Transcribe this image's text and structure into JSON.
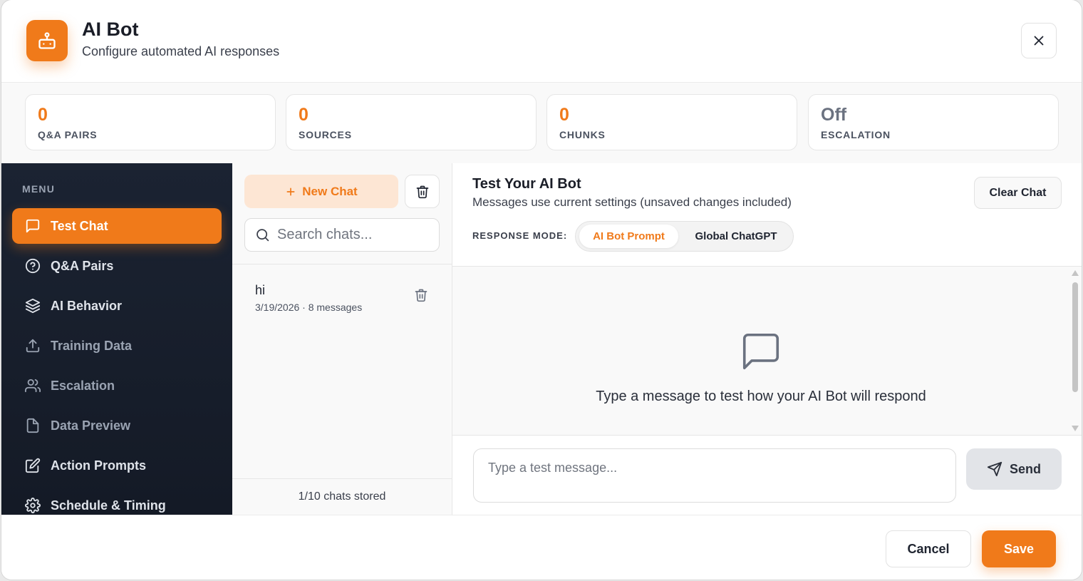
{
  "header": {
    "title": "AI Bot",
    "subtitle": "Configure automated AI responses",
    "icon": "robot-icon"
  },
  "stats": [
    {
      "value": "0",
      "label": "Q&A PAIRS"
    },
    {
      "value": "0",
      "label": "SOURCES"
    },
    {
      "value": "0",
      "label": "CHUNKS"
    },
    {
      "value": "Off",
      "label": "ESCALATION"
    }
  ],
  "sidebar": {
    "menu_label": "MENU",
    "items": [
      {
        "label": "Test Chat",
        "icon": "message-square-icon",
        "active": true
      },
      {
        "label": "Q&A Pairs",
        "icon": "help-circle-icon"
      },
      {
        "label": "AI Behavior",
        "icon": "layers-icon"
      },
      {
        "label": "Training Data",
        "icon": "upload-icon"
      },
      {
        "label": "Escalation",
        "icon": "users-icon"
      },
      {
        "label": "Data Preview",
        "icon": "file-icon"
      },
      {
        "label": "Action Prompts",
        "icon": "edit-icon"
      },
      {
        "label": "Schedule & Timing",
        "icon": "gear-icon"
      }
    ]
  },
  "chat_list": {
    "new_chat_label": "New Chat",
    "search_placeholder": "Search chats...",
    "chats": [
      {
        "name": "hi",
        "meta": "3/19/2026 · 8 messages"
      }
    ],
    "footer": "1/10 chats stored"
  },
  "test_pane": {
    "title": "Test Your AI Bot",
    "subtitle": "Messages use current settings (unsaved changes included)",
    "clear_label": "Clear Chat",
    "mode_label": "RESPONSE MODE:",
    "modes": [
      "AI Bot Prompt",
      "Global ChatGPT"
    ],
    "selected_mode": "AI Bot Prompt",
    "empty_text": "Type a message to test how your AI Bot will respond",
    "input_placeholder": "Type a test message...",
    "send_label": "Send"
  },
  "footer": {
    "cancel_label": "Cancel",
    "save_label": "Save"
  },
  "colors": {
    "accent": "#f07a1a",
    "sidebar_bg": "#1b2332"
  }
}
